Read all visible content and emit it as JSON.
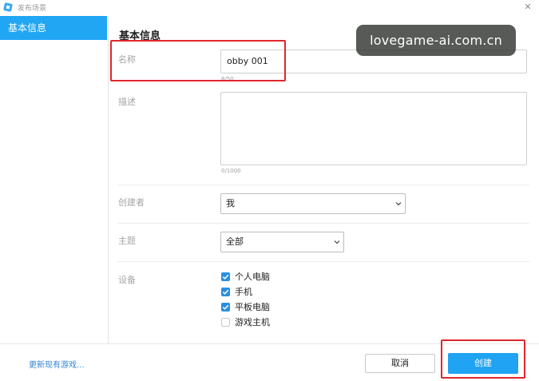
{
  "window": {
    "title": "发布场景",
    "close_glyph": "✕"
  },
  "sidebar": {
    "items": [
      {
        "label": "基本信息",
        "selected": true
      }
    ]
  },
  "main": {
    "section_title": "基本信息",
    "name": {
      "label": "名称",
      "value": "obby 001",
      "counter": "8/50"
    },
    "description": {
      "label": "描述",
      "value": "",
      "counter": "0/1000"
    },
    "creator": {
      "label": "创建者",
      "selected": "我"
    },
    "genre": {
      "label": "主题",
      "selected": "全部"
    },
    "devices": {
      "label": "设备",
      "options": [
        {
          "label": "个人电脑",
          "checked": true
        },
        {
          "label": "手机",
          "checked": true
        },
        {
          "label": "平板电脑",
          "checked": true
        },
        {
          "label": "游戏主机",
          "checked": false
        }
      ]
    }
  },
  "footer": {
    "link_label": "更新现有游戏...",
    "cancel_label": "取消",
    "create_label": "创建"
  },
  "watermark": {
    "text": "lovegame-ai.com.cn"
  },
  "colors": {
    "accent": "#1fa3f2",
    "checkbox": "#2a8fe0",
    "annotation": "#e0262b",
    "link": "#2f86d6"
  },
  "icons": {
    "app": "app-logo-icon",
    "close": "close-icon",
    "dropdown": "chevron-down-icon"
  }
}
